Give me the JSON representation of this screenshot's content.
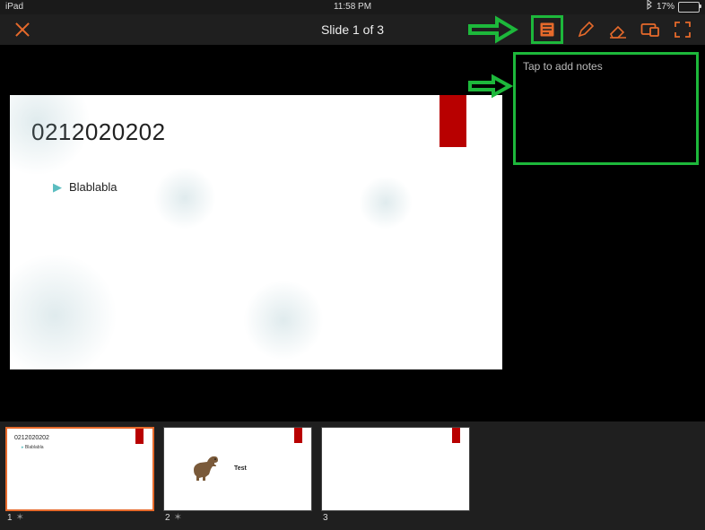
{
  "status_bar": {
    "device": "iPad",
    "time": "11:58 PM",
    "bluetooth_icon": "bluetooth",
    "battery_text": "17%",
    "battery_level": 17
  },
  "toolbar": {
    "close_icon": "close",
    "title": "Slide 1 of 3",
    "icons": {
      "notes": "notes-icon",
      "pen": "pen-icon",
      "eraser": "eraser-icon",
      "mirror": "mirror-display-icon",
      "fullscreen": "fullscreen-icon"
    }
  },
  "slide_main": {
    "title": "0212020202",
    "bullets": [
      "Blablabla"
    ],
    "accent_color": "#b80000"
  },
  "notes_panel": {
    "placeholder": "Tap to add notes"
  },
  "thumbnails": [
    {
      "index": "1",
      "title": "0212020202",
      "bullet": "Blablabla",
      "starred": true,
      "selected": true
    },
    {
      "index": "2",
      "title": "",
      "label": "Test",
      "starred": true,
      "selected": false,
      "has_image": true
    },
    {
      "index": "3",
      "title": "",
      "starred": false,
      "selected": false
    }
  ],
  "annotations": {
    "arrow_icon": "right-arrow",
    "highlight_color": "#1db83b"
  }
}
